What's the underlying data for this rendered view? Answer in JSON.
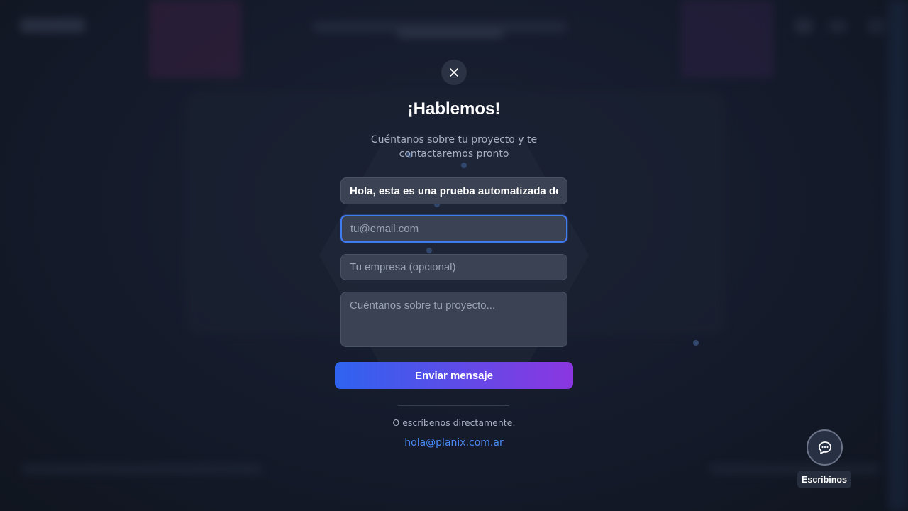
{
  "modal": {
    "title": "¡Hablemos!",
    "subtitle": "Cuéntanos sobre tu proyecto y te contactaremos pronto",
    "close_icon": "close-icon"
  },
  "form": {
    "name_value": "Hola, esta es una prueba automatizada del c",
    "email_placeholder": "tu@email.com",
    "company_placeholder": "Tu empresa (opcional)",
    "message_placeholder": "Cuéntanos sobre tu proyecto...",
    "submit_label": "Enviar mensaje"
  },
  "contact": {
    "alt_text": "O escríbenos directamente:",
    "email": "hola@planix.com.ar"
  },
  "chat_widget": {
    "icon": "chat-bubble-icon",
    "label": "Escribinos"
  },
  "colors": {
    "accent_blue": "#3f7cf0",
    "gradient_start": "#2f63f0",
    "gradient_end": "#8b36e0",
    "link": "#4a8af5"
  }
}
